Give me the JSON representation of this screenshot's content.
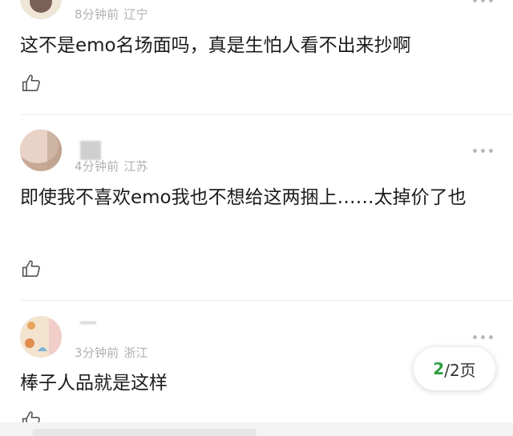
{
  "comments": [
    {
      "time": "8分钟前",
      "location": "辽宁",
      "text": "这不是emo名场面吗，真是生怕人看不出来抄啊",
      "avatar_colors": [
        "#7a6158",
        "#efe6d8"
      ]
    },
    {
      "time": "4分钟前",
      "location": "江苏",
      "text": "即使我不喜欢emo我也不想给这两捆上……太掉价了也",
      "avatar_colors": [
        "#e9d3c6",
        "#c7a995"
      ]
    },
    {
      "time": "3分钟前",
      "location": "浙江",
      "text": "棒子人品就是这样",
      "avatar_colors": [
        "#f3e3cf",
        "#7fb3d9"
      ]
    }
  ],
  "pager": {
    "current": "2",
    "total": "/2页"
  },
  "icons": {
    "like": "thumbs-up-icon",
    "more": "more-dots-icon"
  },
  "colors": {
    "accent": "#2ea043",
    "meta": "#b0b0b0",
    "text": "#1c1c1c"
  }
}
